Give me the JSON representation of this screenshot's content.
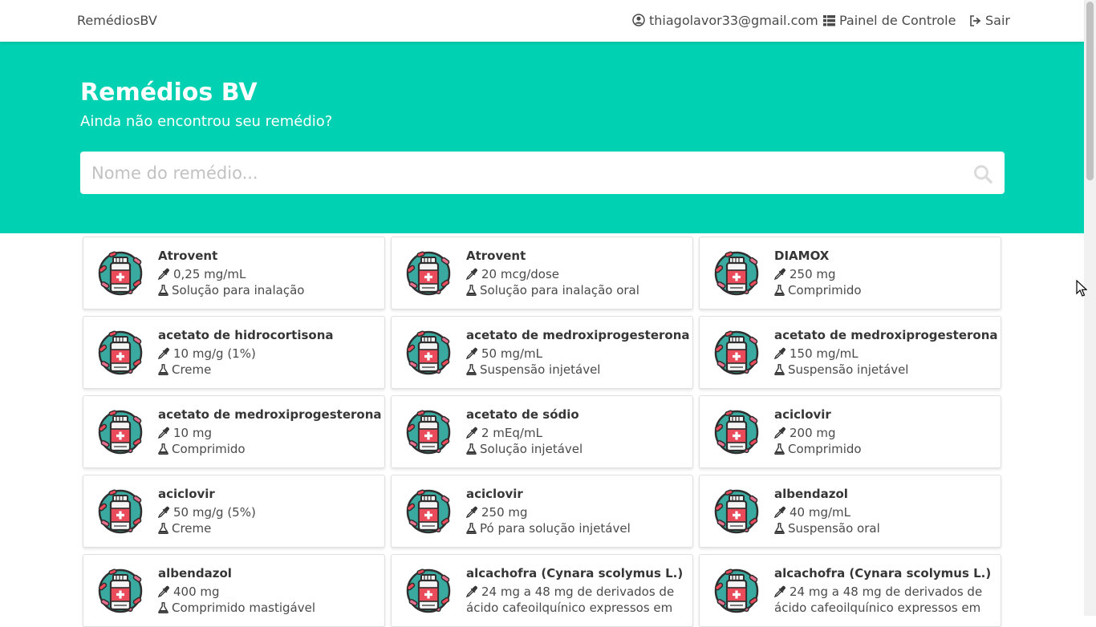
{
  "nav": {
    "brand": "RemédiosBV",
    "user_email": "thiagolavor33@gmail.com",
    "panel_label": "Painel de Controle",
    "logout_label": "Sair"
  },
  "hero": {
    "title": "Remédios BV",
    "subtitle": "Ainda não encontrou seu remédio?",
    "search_placeholder": "Nome do remédio...",
    "search_value": ""
  },
  "colors": {
    "primary": "#00d1b2",
    "pill_teal": "#3aa99f",
    "pill_red": "#e94b5b",
    "pill_pink": "#e8708f"
  },
  "icons": {
    "dose": "dropper-icon",
    "form": "flask-icon",
    "medicine": "medicine-bottle-icon",
    "search": "search-icon"
  },
  "medicines": [
    {
      "name": "Atrovent",
      "dose": "0,25 mg/mL",
      "form": "Solução para inalação"
    },
    {
      "name": "Atrovent",
      "dose": "20 mcg/dose",
      "form": "Solução para inalação oral"
    },
    {
      "name": "DIAMOX",
      "dose": "250 mg",
      "form": "Comprimido"
    },
    {
      "name": "acetato de hidrocortisona",
      "dose": "10 mg/g (1%)",
      "form": "Creme"
    },
    {
      "name": "acetato de medroxiprogesterona",
      "dose": "50 mg/mL",
      "form": "Suspensão injetável"
    },
    {
      "name": "acetato de medroxiprogesterona",
      "dose": "150 mg/mL",
      "form": "Suspensão injetável"
    },
    {
      "name": "acetato de medroxiprogesterona",
      "dose": "10 mg",
      "form": "Comprimido"
    },
    {
      "name": "acetato de sódio",
      "dose": "2 mEq/mL",
      "form": "Solução injetável"
    },
    {
      "name": "aciclovir",
      "dose": "200 mg",
      "form": "Comprimido"
    },
    {
      "name": "aciclovir",
      "dose": "50 mg/g (5%)",
      "form": "Creme"
    },
    {
      "name": "aciclovir",
      "dose": "250 mg",
      "form": "Pó para solução injetável"
    },
    {
      "name": "albendazol",
      "dose": "40 mg/mL",
      "form": "Suspensão oral"
    },
    {
      "name": "albendazol",
      "dose": "400 mg",
      "form": "Comprimido mastigável"
    },
    {
      "name": "alcachofra (Cynara scolymus L.)",
      "dose": "24 mg a 48 mg de derivados de ácido cafeoilquínico expressos em",
      "form": ""
    },
    {
      "name": "alcachofra (Cynara scolymus L.)",
      "dose": "24 mg a 48 mg de derivados de ácido cafeoilquínico expressos em",
      "form": ""
    }
  ]
}
